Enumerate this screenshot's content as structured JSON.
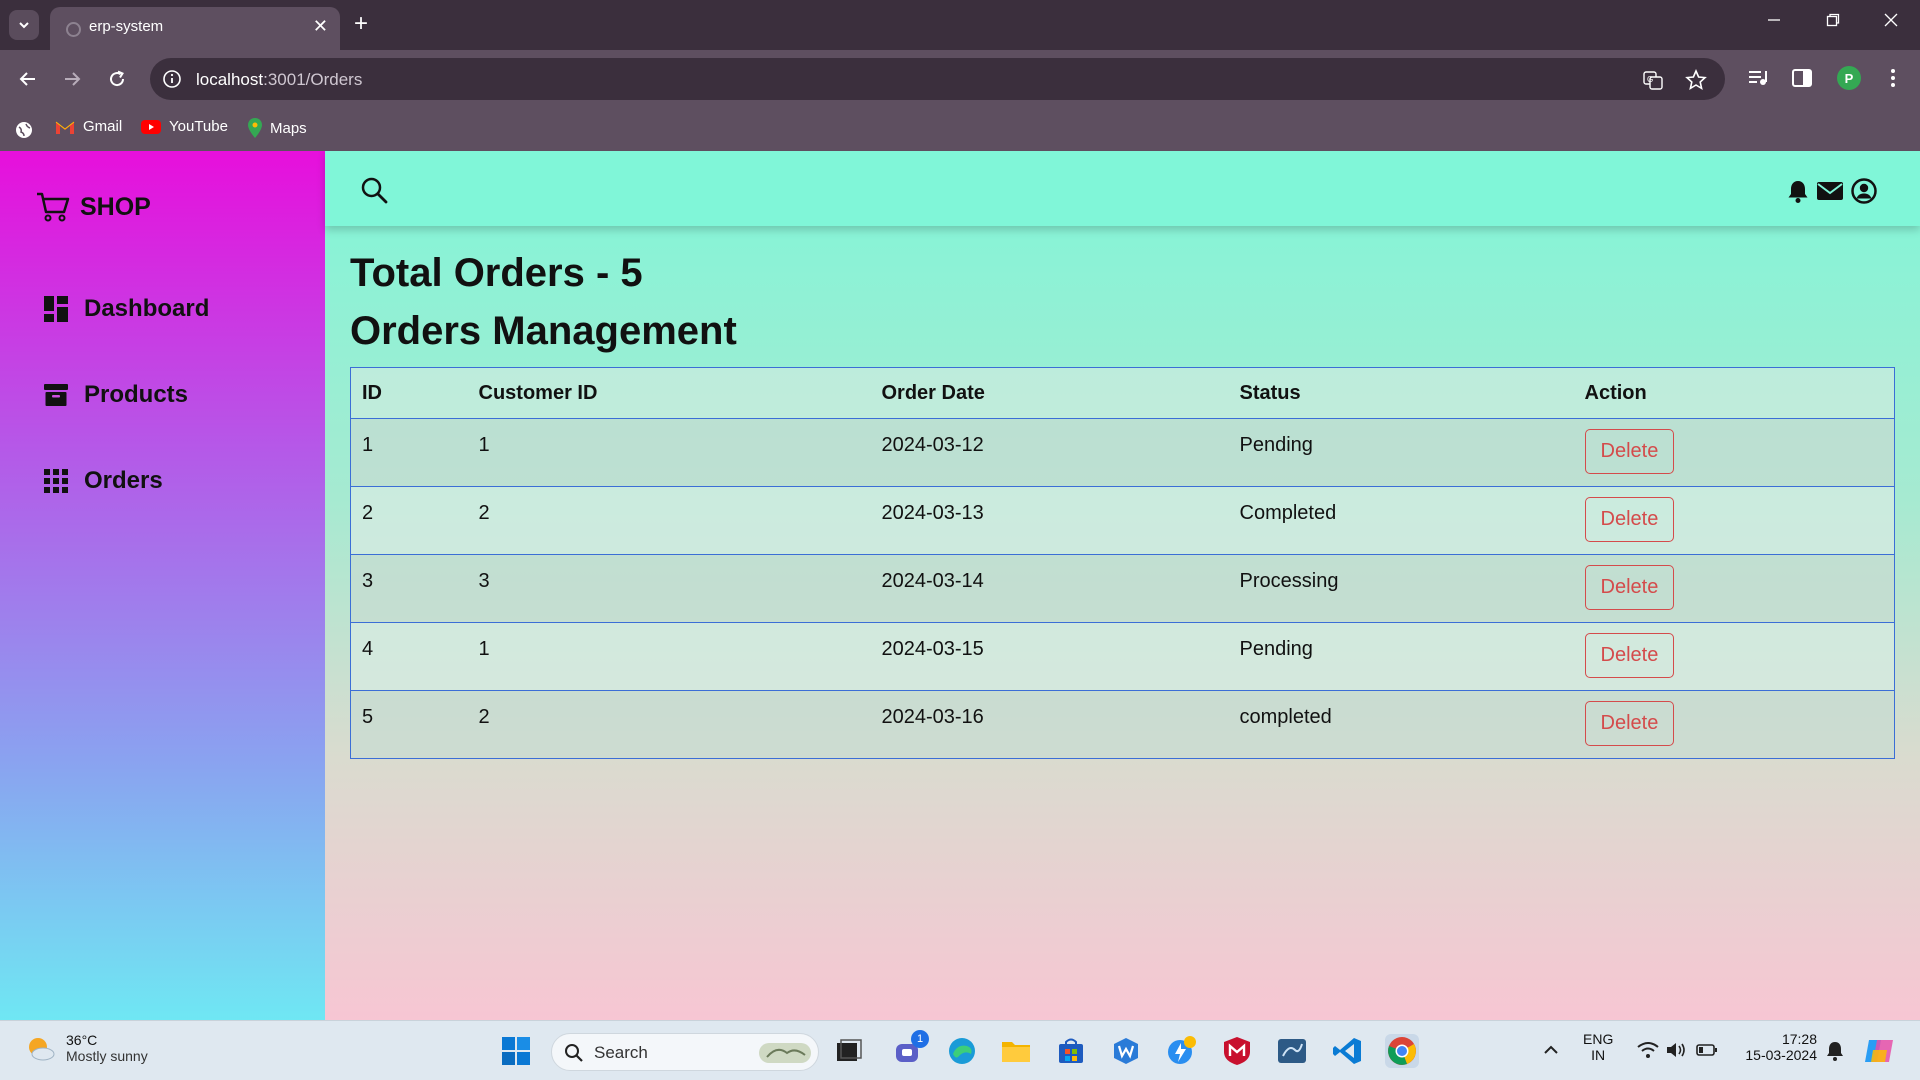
{
  "browser": {
    "tab_title": "erp-system",
    "url_host": "localhost",
    "url_path": ":3001/Orders",
    "profile_initial": "P",
    "bookmarks": [
      {
        "label": "Gmail",
        "icon": "gmail-icon"
      },
      {
        "label": "YouTube",
        "icon": "youtube-icon"
      },
      {
        "label": "Maps",
        "icon": "maps-icon"
      }
    ]
  },
  "sidebar": {
    "brand": "SHOP",
    "items": [
      {
        "label": "Dashboard",
        "icon": "dashboard-icon"
      },
      {
        "label": "Products",
        "icon": "archive-box-icon"
      },
      {
        "label": "Orders",
        "icon": "grid-dots-icon"
      }
    ]
  },
  "main": {
    "total_title": "Total Orders - 5",
    "section_title": "Orders Management",
    "table": {
      "headers": [
        "ID",
        "Customer ID",
        "Order Date",
        "Status",
        "Action"
      ],
      "rows": [
        {
          "id": "1",
          "customer_id": "1",
          "order_date": "2024-03-12",
          "status": "Pending",
          "action": "Delete"
        },
        {
          "id": "2",
          "customer_id": "2",
          "order_date": "2024-03-13",
          "status": "Completed",
          "action": "Delete"
        },
        {
          "id": "3",
          "customer_id": "3",
          "order_date": "2024-03-14",
          "status": "Processing",
          "action": "Delete"
        },
        {
          "id": "4",
          "customer_id": "1",
          "order_date": "2024-03-15",
          "status": "Pending",
          "action": "Delete"
        },
        {
          "id": "5",
          "customer_id": "2",
          "order_date": "2024-03-16",
          "status": "completed",
          "action": "Delete"
        }
      ]
    }
  },
  "taskbar": {
    "weather_temp": "36°C",
    "weather_condition": "Mostly sunny",
    "search_placeholder": "Search",
    "teams_badge": "1",
    "language": "ENG",
    "region": "IN",
    "time": "17:28",
    "date": "15-03-2024"
  },
  "colors": {
    "sidebar_top": "#e70fdc",
    "sidebar_bottom": "#6fe7f3",
    "topbar": "#80f6d8",
    "table_border": "#3b6ed6",
    "delete_red": "#d44b4b"
  }
}
